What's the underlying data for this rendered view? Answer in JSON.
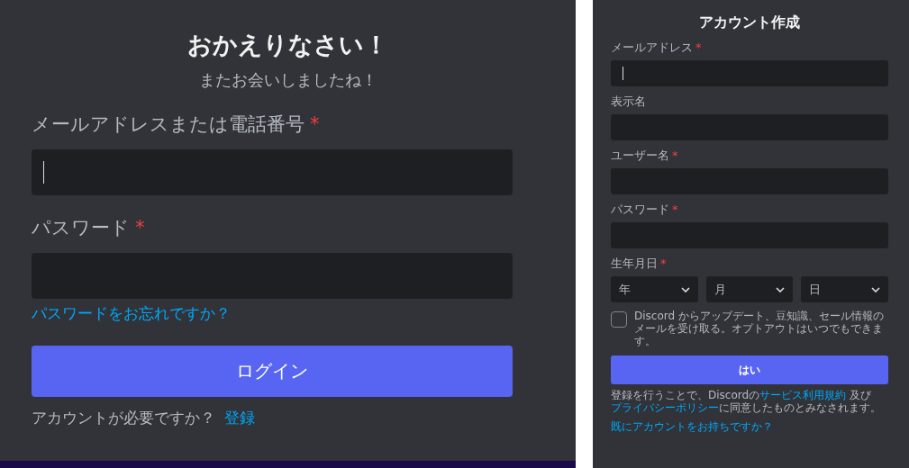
{
  "login": {
    "title": "おかえりなさい！",
    "subtitle": "またお会いしましたね！",
    "fields": [
      {
        "label": "メールアドレスまたは電話番号",
        "mark": "*",
        "focused": true
      },
      {
        "label": "パスワード",
        "mark": "*",
        "focused": false
      }
    ],
    "forgot_link": "パスワードをお忘れですか？",
    "button": "ログイン",
    "prompt": "アカウントが必要ですか？",
    "register_link": "登録"
  },
  "signup": {
    "title": "アカウント作成",
    "fields": [
      {
        "label": "メールアドレス",
        "mark": "*",
        "focused": true
      },
      {
        "label": "表示名",
        "focused": false
      },
      {
        "label": "ユーザー名",
        "mark": "*",
        "focused": false
      },
      {
        "label": "パスワード",
        "mark": "*",
        "focused": false
      }
    ],
    "birthday": {
      "label": "生年月日",
      "mark": "*",
      "selects": [
        {
          "placeholder": "年"
        },
        {
          "placeholder": "月"
        },
        {
          "placeholder": "日"
        }
      ]
    },
    "optin": {
      "checked": false,
      "text": "Discord からアップデート、豆知識、セール情報のメールを受け取る。オプトアウトはいつでもできます。"
    },
    "button": "はい",
    "terms": [
      {
        "kind": "text",
        "text": "登録を行うことで、Discordの"
      },
      {
        "kind": "link",
        "text": "サービス利用規約"
      },
      {
        "kind": "text",
        "text": " 及び "
      },
      {
        "kind": "link",
        "text": "プライバシーポリシー"
      },
      {
        "kind": "text",
        "text": "に同意したものとみなされます。"
      }
    ],
    "login_link": "既にアカウントをお持ちですか？"
  }
}
